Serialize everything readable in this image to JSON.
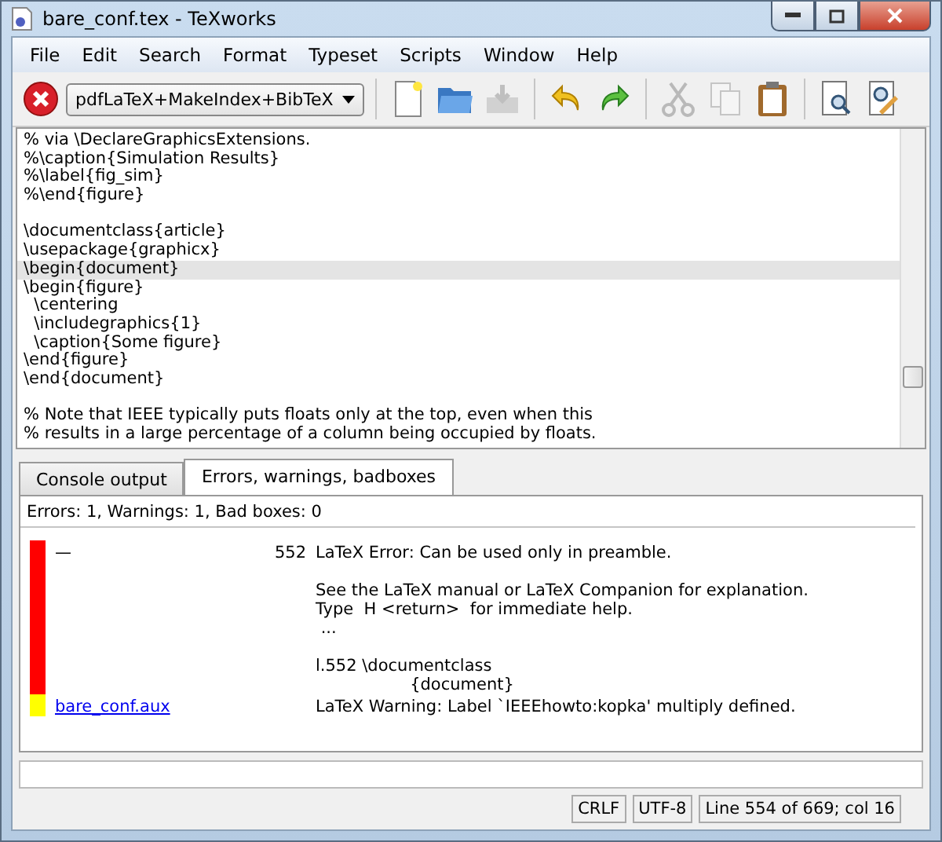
{
  "window": {
    "title": "bare_conf.tex - TeXworks"
  },
  "menu": [
    "File",
    "Edit",
    "Search",
    "Format",
    "Typeset",
    "Scripts",
    "Window",
    "Help"
  ],
  "toolbar": {
    "engine": "pdfLaTeX+MakeIndex+BibTeX",
    "tools": [
      {
        "kind": "new",
        "disabled": false
      },
      {
        "kind": "open",
        "disabled": false
      },
      {
        "kind": "save",
        "disabled": true
      },
      {
        "kind": "undo",
        "disabled": false
      },
      {
        "kind": "redo",
        "disabled": false
      },
      {
        "kind": "cut",
        "disabled": true
      },
      {
        "kind": "copy",
        "disabled": true
      },
      {
        "kind": "paste",
        "disabled": false
      },
      {
        "kind": "find",
        "disabled": false
      },
      {
        "kind": "replace",
        "disabled": false
      }
    ]
  },
  "editor": {
    "blocks": [
      [
        {
          "text": "% via \\DeclareGraphicsExtensions.",
          "current": false
        },
        {
          "text": "%\\caption{Simulation Results}",
          "current": false
        },
        {
          "text": "%\\label{fig_sim}",
          "current": false
        },
        {
          "text": "%\\end{figure}",
          "current": false
        }
      ],
      [
        {
          "text": "\\documentclass{article}",
          "current": false
        },
        {
          "text": "\\usepackage{graphicx}",
          "current": false
        },
        {
          "text": "\\begin{document}",
          "current": true
        },
        {
          "text": "\\begin{figure}",
          "current": false
        },
        {
          "text": "  \\centering",
          "current": false
        },
        {
          "text": "  \\includegraphics{1}",
          "current": false
        },
        {
          "text": "  \\caption{Some figure}",
          "current": false
        },
        {
          "text": "\\end{figure}",
          "current": false
        },
        {
          "text": "\\end{document}",
          "current": false
        }
      ],
      [
        {
          "text": "% Note that IEEE typically puts floats only at the top, even when this",
          "current": false
        },
        {
          "text": "% results in a large percentage of a column being occupied by floats.",
          "current": false
        }
      ]
    ]
  },
  "tabs": [
    {
      "label": "Console output",
      "selected": false
    },
    {
      "label": "Errors, warnings, badboxes",
      "selected": true
    }
  ],
  "log": {
    "summary": "Errors: 1, Warnings: 1, Bad boxes: 0",
    "entries": [
      {
        "kind": "error",
        "color": "#ff0000",
        "file": "—",
        "line": "552",
        "message": "LaTeX Error: Can be used only in preamble.\n\nSee the LaTeX manual or LaTeX Companion for explanation.\nType  H <return>  for immediate help.\n ...\n\nl.552 \\documentclass\n                  {document}"
      },
      {
        "kind": "warning",
        "color": "#ffff00",
        "file": "bare_conf.aux",
        "message": "LaTeX Warning: Label `IEEEhowto:kopka' multiply defined."
      }
    ]
  },
  "status_bar": [
    "CRLF",
    "UTF-8",
    "Line 554 of 669; col 16"
  ]
}
